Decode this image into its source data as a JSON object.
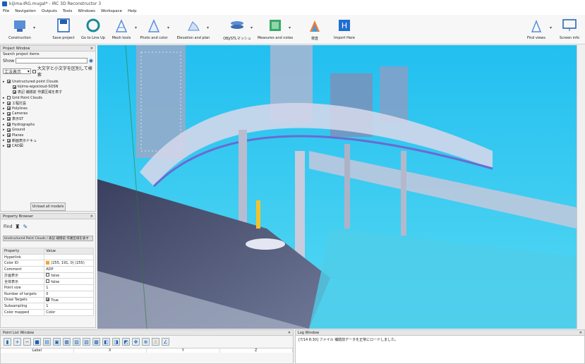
{
  "window": {
    "title": "kijima-IRG.mugal* - IRC 3D Reconstructor 3"
  },
  "menu": [
    "File",
    "Navigation",
    "Outputs",
    "Tools",
    "Windows",
    "Workspace",
    "Help"
  ],
  "ribbon": [
    {
      "label": "Construction"
    },
    {
      "label": "Save project"
    },
    {
      "label": "Go to Line Up"
    },
    {
      "label": "Mesh tools"
    },
    {
      "label": "Photo and color"
    },
    {
      "label": "Elevation and plan"
    },
    {
      "label": "OBJ/STLマッシュ"
    },
    {
      "label": "Measures and notes"
    },
    {
      "label": "検査"
    },
    {
      "label": "Import Here"
    },
    {
      "label": "Find views"
    },
    {
      "label": "Screen info"
    }
  ],
  "project_window": {
    "title": "Project Window",
    "search_label": "Search project items",
    "show_label": "Show",
    "filter_value": "工法表示",
    "filter_check": "大文字と小文字を区別して検索",
    "tree": [
      {
        "label": "Unstructured point Clouds",
        "checked": true,
        "indent": 0
      },
      {
        "label": "kijima-wgsicloud-SOSN",
        "checked": true,
        "indent": 1
      },
      {
        "label": "表記 補繕前 作業区域を表す",
        "checked": true,
        "indent": 1
      },
      {
        "label": "Grid Point Clouds",
        "checked": false,
        "indent": 0
      },
      {
        "label": "工程打設",
        "checked": true,
        "indent": 0
      },
      {
        "label": "Polylines",
        "checked": true,
        "indent": 0
      },
      {
        "label": "Cameras",
        "checked": true,
        "indent": 0
      },
      {
        "label": "表示ST",
        "checked": true,
        "indent": 0
      },
      {
        "label": "Hydrographs",
        "checked": true,
        "indent": 0
      },
      {
        "label": "Ground",
        "checked": true,
        "indent": 0
      },
      {
        "label": "Planes",
        "checked": true,
        "indent": 0
      },
      {
        "label": "断面表示ドキュ",
        "checked": true,
        "indent": 0
      },
      {
        "label": "CAD図",
        "checked": true,
        "indent": 0
      }
    ],
    "unload_label": "Unload all models"
  },
  "property_browser": {
    "title": "Property Browser",
    "find_label": "Find",
    "path_label": "Unstructured Point Clouds / 表記 補繕前 作業区域を表す",
    "headers": [
      "Property",
      "Value"
    ],
    "rows": [
      {
        "k": "Hyperlink",
        "v": ""
      },
      {
        "k": "Color ID",
        "v": "(255, 191, 0) (255)"
      },
      {
        "k": "Comment",
        "v": "ADP"
      },
      {
        "k": "計画表示",
        "v": "false"
      },
      {
        "k": "全体表示",
        "v": "false"
      },
      {
        "k": "Point size",
        "v": "1"
      },
      {
        "k": "Number of targets",
        "v": "0"
      },
      {
        "k": "Draw Targets",
        "v": "True"
      },
      {
        "k": "Subsampling",
        "v": "1"
      },
      {
        "k": "Color mapped",
        "v": "Color"
      }
    ]
  },
  "point_list": {
    "title": "Point List Window",
    "columns": [
      "Label",
      "X",
      "Y",
      "Z"
    ]
  },
  "log_window": {
    "title": "Log Window",
    "text": "[7/14 8:30] ファイル 補繕前データを正常にロードしました。"
  },
  "colors": {
    "viewport": "#2cc4ec",
    "accent": "#1e5fb4",
    "swatch": "#f5a623"
  }
}
